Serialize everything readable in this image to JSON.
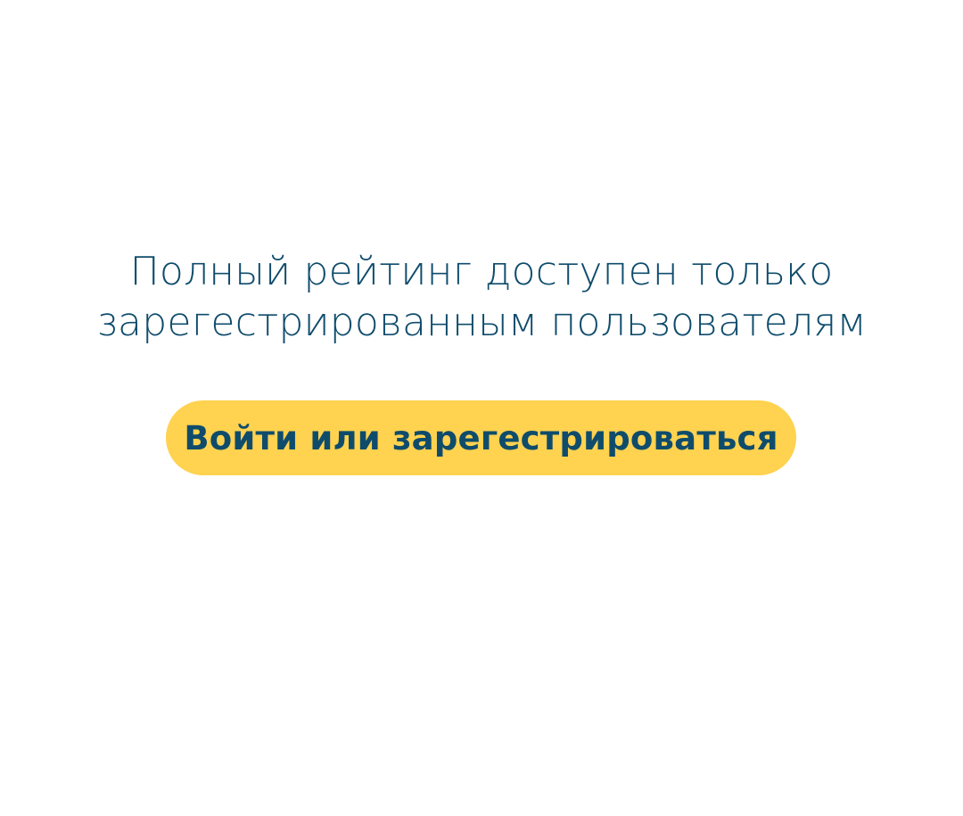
{
  "message": {
    "line1": "Полный рейтинг доступен только",
    "line2": "зарегестрированным пользователям"
  },
  "cta": {
    "label": "Войти или зарегестрироваться"
  },
  "colors": {
    "background": "#ffffff",
    "text": "#0f4c6c",
    "button": "#ffd24f"
  }
}
